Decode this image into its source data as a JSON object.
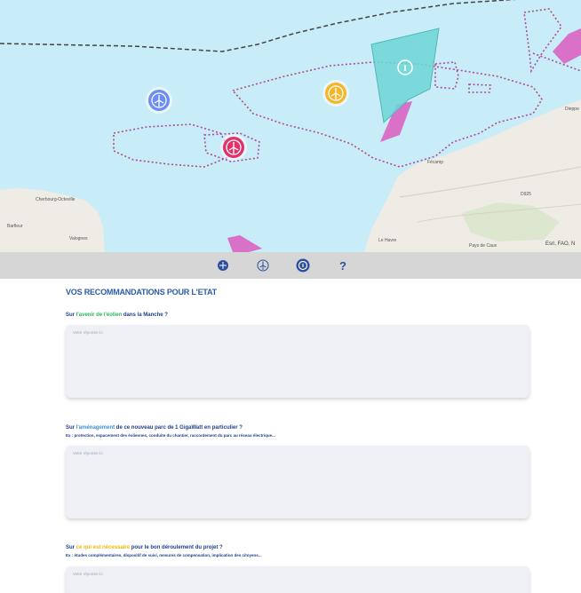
{
  "map": {
    "labels": {
      "cherbourg": "Cherbourg-Octeville",
      "valognes": "Valognes",
      "barfleur": "Barfleur",
      "fecamp": "Fécamp",
      "le_havre": "Le Havre",
      "dieppe": "Dieppe",
      "attribution": "Esri, FAO, N",
      "caux": "Pays de Caux",
      "road": "D925"
    },
    "colors": {
      "sea": "#c9ecf9",
      "land": "#eeece4",
      "zone_pink": "#d971c8",
      "zone_cyan": "#6ed6d6",
      "dotted": "#b04a9b"
    },
    "markers": [
      {
        "name": "blue",
        "color": "#6b8df5",
        "icon": "wind-turbine-icon"
      },
      {
        "name": "pink",
        "color": "#e0326b",
        "icon": "wind-turbine-icon"
      },
      {
        "name": "yellow",
        "color": "#f7b52a",
        "icon": "wind-turbine-icon"
      },
      {
        "name": "info",
        "color": "#ffffff",
        "icon": "info-icon"
      }
    ]
  },
  "toolbar": {
    "tools": [
      {
        "icon": "layers-icon"
      },
      {
        "icon": "wind-turbine-icon"
      },
      {
        "icon": "info-icon"
      },
      {
        "icon": "help-icon",
        "label": "?"
      }
    ]
  },
  "form": {
    "title": "VOS RECOMMANDATIONS POUR L'ETAT",
    "q1": {
      "pre": "Sur ",
      "hl": "l'avenir de l'éolien",
      "post": " dans la Manche ?",
      "placeholder": "Votre réponse ici"
    },
    "q2": {
      "pre": "Sur ",
      "hl": "l'aménagement",
      "post": " de ce nouveau parc de 1 GigaWatt en particulier ?",
      "sub": "Ex : protection, espacement des éoliennes, conduite du chantier, raccordement du parc au réseau électrique...",
      "placeholder": "Votre réponse ici"
    },
    "q3": {
      "pre": "Sur ",
      "hl": "ce qui est nécessaire",
      "post": " pour le bon déroulement du projet ?",
      "sub": "Ex : études complémentaires, dispositif de suivi, mesures de compensation, implication des citoyens...",
      "placeholder": "Votre réponse ici"
    }
  }
}
